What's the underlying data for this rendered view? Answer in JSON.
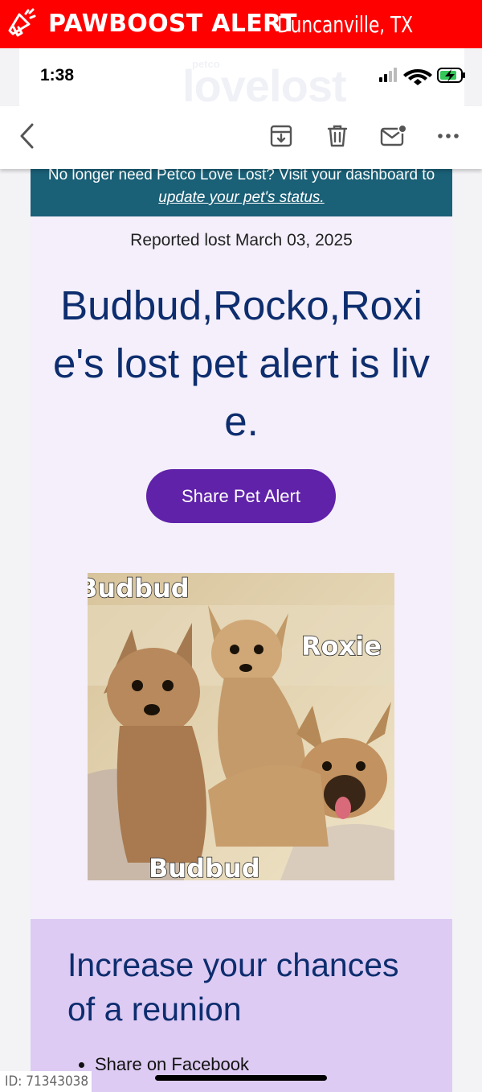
{
  "banner": {
    "title": "PAWBOOST ALERT",
    "location": "Duncanville, TX",
    "bg_color": "#fe0000",
    "icon": "megaphone-icon"
  },
  "status_bar": {
    "time": "1:38",
    "watermark_small": "petco",
    "watermark_big": "lovelost",
    "icons": [
      "signal-icon",
      "wifi-icon",
      "battery-charging-icon"
    ]
  },
  "toolbar": {
    "icons": [
      "back-chevron-icon",
      "archive-icon",
      "trash-icon",
      "mark-unread-icon",
      "more-icon"
    ]
  },
  "email": {
    "notice_prefix": "No longer need Petco Love Lost? Visit your dashboard to",
    "notice_link": "update your pet's status.",
    "reported": "Reported lost March 03, 2025",
    "headline": "Budbud,Rocko,Roxie's lost pet alert is live.",
    "share_button": "Share Pet Alert",
    "photo_labels": {
      "top_left": "Budbud",
      "right": "Roxie",
      "bottom": "Budbud"
    },
    "reunion_title": "Increase your chances of a reunion",
    "reunion_items": [
      "Share on Facebook"
    ],
    "colors": {
      "notice_bg": "#1a6077",
      "headline": "#0d2d6e",
      "button": "#6022a9",
      "reunion_bg": "#ddcbf3",
      "email_bg": "#f4effa"
    }
  },
  "footer": {
    "id_label": "ID: 71343038"
  }
}
